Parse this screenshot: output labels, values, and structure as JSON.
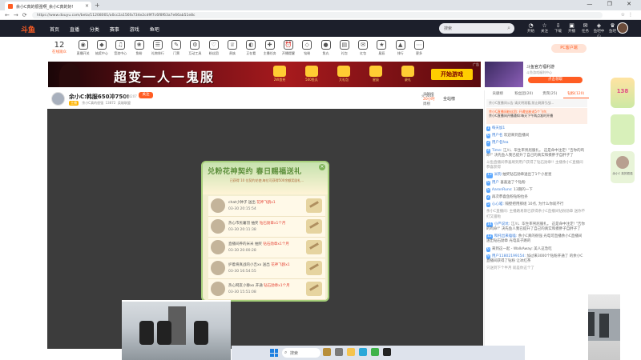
{
  "browser": {
    "tab_title": "余小C真的很强啊_余小C真的好!",
    "url": "https://www.douyu.com/beta/11208001/a0cc2a156fa734e2cd9f7c6f8f63a7e66ab51e8c",
    "tab_close": "×",
    "new_tab": "+",
    "window_controls": "— ❐ ✕"
  },
  "header": {
    "logo": "斗鱼",
    "nav": [
      "首页",
      "直播",
      "分类",
      "赛事",
      "游戏",
      "鱼吧"
    ],
    "search_placeholder": "搜索",
    "icons": [
      {
        "icon": "bell-icon",
        "label": "开始"
      },
      {
        "icon": "star-icon",
        "label": "关注"
      },
      {
        "icon": "download-icon",
        "label": "下载"
      },
      {
        "icon": "live-icon",
        "label": "开播"
      },
      {
        "icon": "task-icon",
        "label": "任务"
      },
      {
        "icon": "game-icon",
        "label": "鱼吧中心"
      },
      {
        "icon": "vip-icon",
        "label": "鱼吧"
      }
    ]
  },
  "toolbar": {
    "online_count": "12",
    "online_label": "在线观众",
    "tools": [
      "直播开关",
      "抽奖中心",
      "音浪中心",
      "鱼粉",
      "礼物排行",
      "门票",
      "互动工具",
      "粉丝团",
      "贵族",
      "正在看",
      "主播任务",
      "开播提醒",
      "钻粉",
      "鱼丸",
      "礼包",
      "红包",
      "星辰",
      "排行",
      "更多"
    ],
    "pc_button": "PC客户端"
  },
  "banner": {
    "title": "超变一人一鬼服",
    "prizes": [
      "2W首充",
      "500鱼丸",
      "大礼包",
      "星辰",
      "豪礼"
    ],
    "play_button": "开始游戏",
    "ad_tag": "广告"
  },
  "side_ad": {
    "title": "斗鱼官方福利游",
    "subtitle": "斗鱼游戏福利中心",
    "button": "点击领取"
  },
  "streamer": {
    "title": "余小C:韩服650冲750!",
    "room_id": "3154207",
    "follow": "关注",
    "tags": [
      "主播",
      "余小C真的很强",
      "13872",
      "英雄联盟"
    ],
    "hot_label": "火",
    "hot_value": "5210",
    "whole_site": "全站榜",
    "rank_label": "贡献榜",
    "rank_value": "20小时",
    "rank_week": "周榜"
  },
  "modal": {
    "title": "兑粉花神契约 春日赐福送礼",
    "subtitle": "已获得 10 位契约花使,每位可获得500余额奖励礼...",
    "close": "×",
    "rows": [
      {
        "user": "chat小钟子",
        "action": "送出",
        "gift": "花神飞鸥x1",
        "time": "03-30 20:15:54"
      },
      {
        "user": "热心市民薯羽",
        "action": "抽奖",
        "gift": "钻石勋章x1个月",
        "time": "03-30 20:11:38"
      },
      {
        "user": "直播间养的米米",
        "action": "抽奖",
        "gift": "钻石勋章x1个月",
        "time": "03-30 20:00:28"
      },
      {
        "user": "护着将真战的小吉xx",
        "action": "送出",
        "gift": "花神飞鸥x1",
        "time": "03-30 16:54:55"
      },
      {
        "user": "热心网友小静xo",
        "action": "开通",
        "gift": "钻石勋章x1个月",
        "time": "03-30 15:51:08"
      }
    ]
  },
  "chat": {
    "tabs": [
      "贡献榜",
      "粉丝团(20)",
      "贵宾(25)",
      "钻粉(120)"
    ],
    "notice": "余小C直播间公告 请文明观看,禁止刷屏引战...",
    "pinned_line1": "余小C直播间粉丝团: 开通钻粉送5个飞鸟",
    "pinned_line2": "余小C直播间开播通知:每天下午两点准时开播",
    "messages": [
      {
        "lv": "1",
        "name": "每天加1",
        "text": ""
      },
      {
        "lv": "6",
        "name": "用户名",
        "text": "欢迎来到直播间"
      },
      {
        "lv": "2",
        "name": "用户名fea",
        "text": ""
      },
      {
        "lv": "4",
        "name": "Time:",
        "text": "江川、毕生率男屈服扎。 这是命中注定! \"吉你的鸡命!\" 决先鱼人我已提升了自己的真实和摸胖子自胖子了"
      },
      {
        "lv": "",
        "name": "",
        "text": "斗鱼直播间恭喜刷到用户获得了钻石勋章!! 主播余小C直播间恭喜获得",
        "sys": true
      },
      {
        "lv": "13",
        "name": "米狗",
        "text": "抽奖钻石勋章送出了1个小星星"
      },
      {
        "lv": "9",
        "name": "用户",
        "text": "喜喜送了个钻粉"
      },
      {
        "lv": "8",
        "name": "AaronRuns:",
        "text": "13期的一下"
      },
      {
        "lv": "2",
        "name": "",
        "text": "再次恭喜鱼粉钻粉拉条"
      },
      {
        "lv": "5",
        "name": "心心喵:",
        "text": "隔壁把用那组 10点, 为什么你就不行"
      },
      {
        "lv": "",
        "name": "",
        "text": "余小C直播间: 主播路易斯已获得余小C直播间钻粉勋章 送你不打又骚啦",
        "sys": true
      },
      {
        "lv": "14",
        "name": "小严说坑:",
        "text": "江川、毕生率男屈服扎。 这是命中注定! \"吉你的鸡命!\" 决先鱼人我已提升了自己的真实和摸胖子自胖子了"
      },
      {
        "lv": "12",
        "name": "和托出来嗑嗑:",
        "text": "余小C真的很强 光电可直播余小C直播间 送出钻石勋章 光电美子路的"
      },
      {
        "lv": "6",
        "name": "",
        "text": "来到这一起 - WalkAway: 美人这急吃"
      },
      {
        "lv": "9",
        "name": "用户11802199154:",
        "text": "加过来3000个钻粉开通了 的余小C直播间获得了钻粉 让冰红茶"
      },
      {
        "lv": "",
        "name": "",
        "text": "只送到下个半月 就差你这个了",
        "sys": true
      }
    ]
  },
  "float_col": {
    "badge": "138",
    "caption": "余小C 真的很强"
  },
  "taskbar": {
    "search": "搜索"
  }
}
